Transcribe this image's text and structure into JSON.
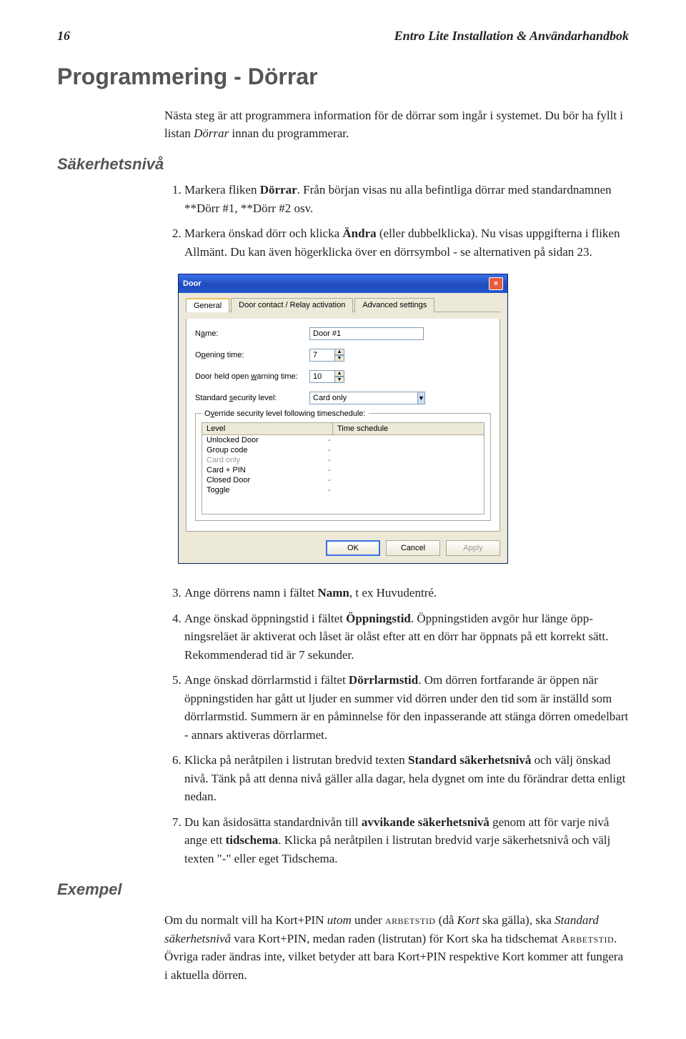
{
  "header": {
    "page": "16",
    "title": "Entro Lite Installation & Användarhandbok"
  },
  "h1": "Programmering - Dörrar",
  "intro": {
    "p1a": "Nästa steg är att programmera information för de dörrar som ingår i systemet. Du bör ha fyllt i listan ",
    "p1_em": "Dörrar",
    "p1b": " innan du programmerar."
  },
  "h2_sakerhet": "Säkerhetsnivå",
  "steps1": {
    "s1a": "Markera fliken ",
    "s1_bold": "Dörrar",
    "s1b": ". Från början visas nu alla befintliga dörrar med standardnamnen **Dörr #1, **Dörr #2 osv.",
    "s2a": "Markera önskad dörr och klicka ",
    "s2_bold": "Ändra",
    "s2b": " (eller dubbelklicka). Nu visas uppgifterna i fli­ken Allmänt. Du kan även högerklicka över en dörrsymbol - se alternativen på sidan 23."
  },
  "dialog": {
    "title": "Door",
    "tabs": {
      "general": "General",
      "contact": "Door contact / Relay activation",
      "advanced": "Advanced settings"
    },
    "labels": {
      "name_pre": "N",
      "name_under": "a",
      "name_post": "me:",
      "opening_pre": "O",
      "opening_under": "p",
      "opening_post": "ening time:",
      "warn_pre": "Door held open ",
      "warn_under": "w",
      "warn_post": "arning time:",
      "seclvl_pre": "Standard ",
      "seclvl_under": "s",
      "seclvl_post": "ecurity level:"
    },
    "values": {
      "name": "Door #1",
      "opening": "7",
      "warn": "10",
      "seclvl": "Card only"
    },
    "override_legend_pre": "O",
    "override_legend_under": "v",
    "override_legend_post": "erride security level following timeschedule:",
    "list": {
      "col_level": "Level",
      "col_ts": "Time schedule",
      "rows": [
        {
          "level": "Unlocked Door",
          "ts": "-",
          "disabled": false
        },
        {
          "level": "Group code",
          "ts": "-",
          "disabled": false
        },
        {
          "level": "Card only",
          "ts": "-",
          "disabled": true
        },
        {
          "level": "Card + PIN",
          "ts": "-",
          "disabled": false
        },
        {
          "level": "Closed Door",
          "ts": "-",
          "disabled": false
        },
        {
          "level": "Toggle",
          "ts": "-",
          "disabled": false
        }
      ]
    },
    "buttons": {
      "ok": "OK",
      "cancel": "Cancel",
      "apply": "Apply"
    }
  },
  "steps2": {
    "s3a": "Ange dörrens namn i fältet ",
    "s3_bold": "Namn",
    "s3b": ", t ex Huvudentré.",
    "s4a": "Ange önskad öppningstid i fältet ",
    "s4_bold": "Öppningstid",
    "s4b": ". Öppningstiden avgör hur länge öpp­ningsreläet är aktiverat och låset är olåst efter att en dörr har öppnats på ett korrekt sätt. Rekommenderad tid är 7 sekunder.",
    "s5a": "Ange önskad dörrlarmstid i fältet ",
    "s5_bold": "Dörrlarmstid",
    "s5b": ". Om dörren fortfarande är öppen när öppningstiden har gått ut ljuder en summer vid dörren under den tid som är inställd som dörrlarmstid. Summern är en påminnelse för den inpasserande att stänga dörren omedelbart - annars aktiveras dörrlarmet.",
    "s6a": "Klicka på neråtpilen i listrutan bredvid texten ",
    "s6_bold": "Standard säkerhetsnivå",
    "s6b": " och välj önskad nivå. Tänk på att denna nivå gäller alla dagar, hela dygnet om inte du förändrar detta enligt nedan.",
    "s7a": "Du kan åsidosätta standardnivån till ",
    "s7_bold1": "avvikande säkerhetsnivå",
    "s7b": " genom att för varje nivå ange ett ",
    "s7_bold2": "tidschema",
    "s7c": ". Klicka på neråtpilen i listrutan bredvid varje säkerhetsnivå och välj texten \"-\" eller eget Tidschema."
  },
  "example": {
    "heading": "Exempel",
    "p1a": "Om du normalt vill ha Kort+PIN ",
    "p1_em1": "utom",
    "p1b": " under ",
    "p1_sc1": "arbetstid",
    "p1c": " (då ",
    "p1_em2": "Kort",
    "p1d": " ska gälla), ska ",
    "p1_em3": "Standard säkerhetsnivå",
    "p1e": " vara Kort+PIN, medan raden (listrutan) för Kort ska ha tidschemat ",
    "p1_sc2": "Arbetstid",
    "p1f": ". Övriga rader ändras inte, vilket betyder att bara Kort+PIN respektive Kort kom­mer att fungera i aktuella dörren."
  }
}
